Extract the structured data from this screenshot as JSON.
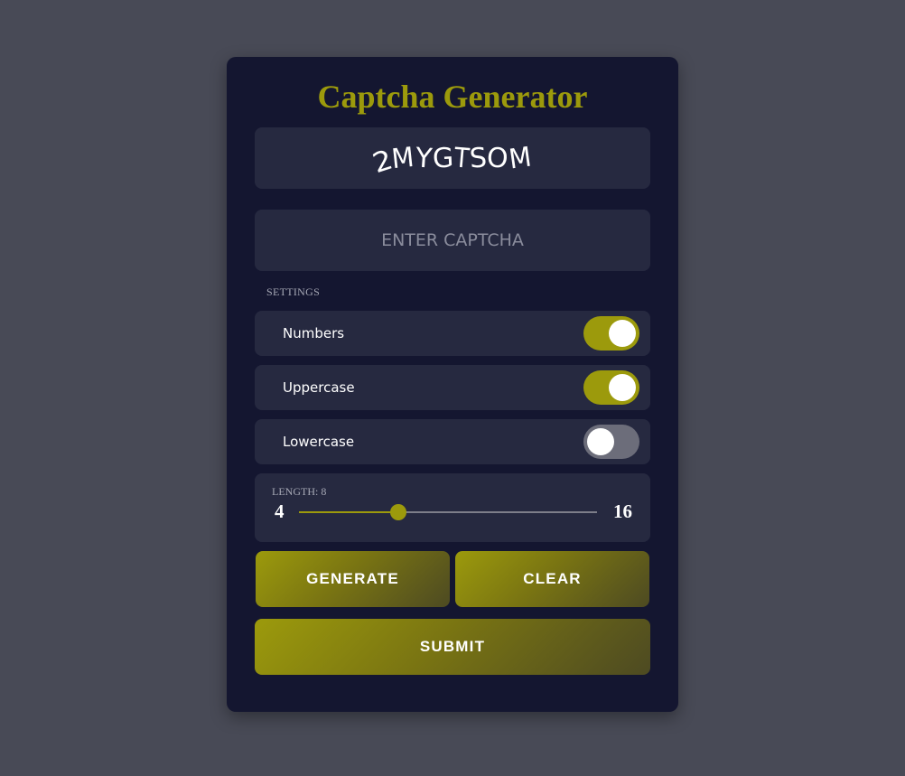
{
  "app": {
    "title": "Captcha Generator"
  },
  "captcha": {
    "text": "2MYGTSOM",
    "chars": [
      "2",
      "M",
      "Y",
      "G",
      "T",
      "S",
      "O",
      "M"
    ]
  },
  "input": {
    "placeholder": "ENTER CAPTCHA",
    "value": ""
  },
  "settings": {
    "heading": "SETTINGS",
    "options": [
      {
        "label": "Numbers",
        "enabled": true
      },
      {
        "label": "Uppercase",
        "enabled": true
      },
      {
        "label": "Lowercase",
        "enabled": false
      }
    ],
    "length": {
      "label": "LENGTH: 8",
      "value": 8,
      "min": 4,
      "max": 16,
      "min_label": "4",
      "max_label": "16"
    }
  },
  "buttons": {
    "generate": "GENERATE",
    "clear": "CLEAR",
    "submit": "SUBMIT"
  },
  "colors": {
    "accent": "#9c9a0c",
    "background": "#484a56",
    "card": "#141630",
    "panel": "#262940"
  }
}
